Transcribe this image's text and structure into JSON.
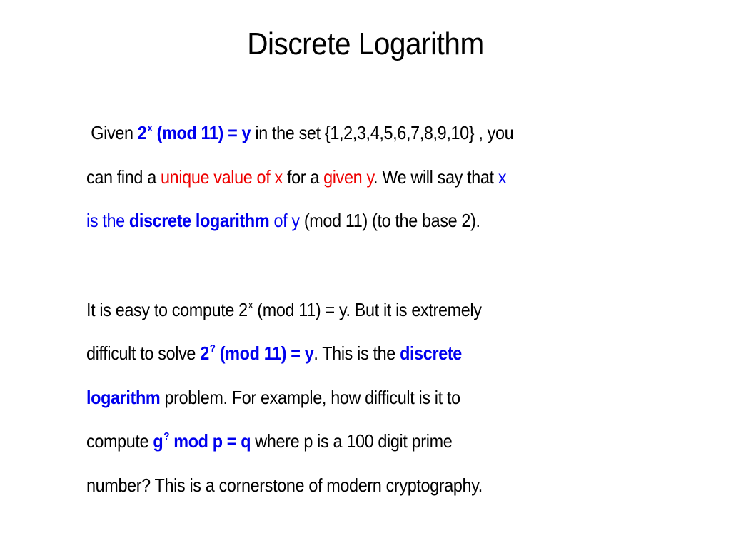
{
  "slide": {
    "title": "Discrete Logarithm",
    "paragraph1": {
      "line1": {
        "t1": "Given ",
        "b1_base": "2",
        "b1_sup": "x",
        "b1_rest": " (mod 11) = y",
        "t2": " in the set {1,2,3,4,5,6,7,8,9,10} , you"
      },
      "line2": {
        "t1": "can find a ",
        "r1": "unique value of x",
        "t2": " for a ",
        "r2": "given y",
        "t3": ". We will say that ",
        "bl1": "x"
      },
      "line3": {
        "bl1": "is the  ",
        "bb1": "discrete logarithm",
        "bl2": " of y",
        "t1": " (mod 11) (to the base 2)."
      }
    },
    "paragraph2": {
      "line1": {
        "t1": "It is easy to compute 2",
        "sup": "x",
        "t2": " (mod 11) = y. But it is extremely"
      },
      "line2": {
        "t1": "difficult to solve ",
        "b1_base": "2",
        "b1_sup": "?",
        "b1_rest": " (mod 11) = y",
        "t2": ". This is the ",
        "b2": "discrete"
      },
      "line3": {
        "b1": "logarithm",
        "t1": " problem. For example, how difficult is it to"
      },
      "line4": {
        "t1": "compute  ",
        "b1_base": "g",
        "b1_sup": "?",
        "b1_rest": " mod p = q",
        "t2": " where p is a 100 digit prime"
      },
      "line5": {
        "t1": "number? This is a cornerstone of modern cryptography."
      }
    }
  },
  "colors": {
    "emphasis_blue": "#0000ee",
    "emphasis_red": "#ee0000",
    "text": "#000000",
    "background": "#ffffff"
  }
}
